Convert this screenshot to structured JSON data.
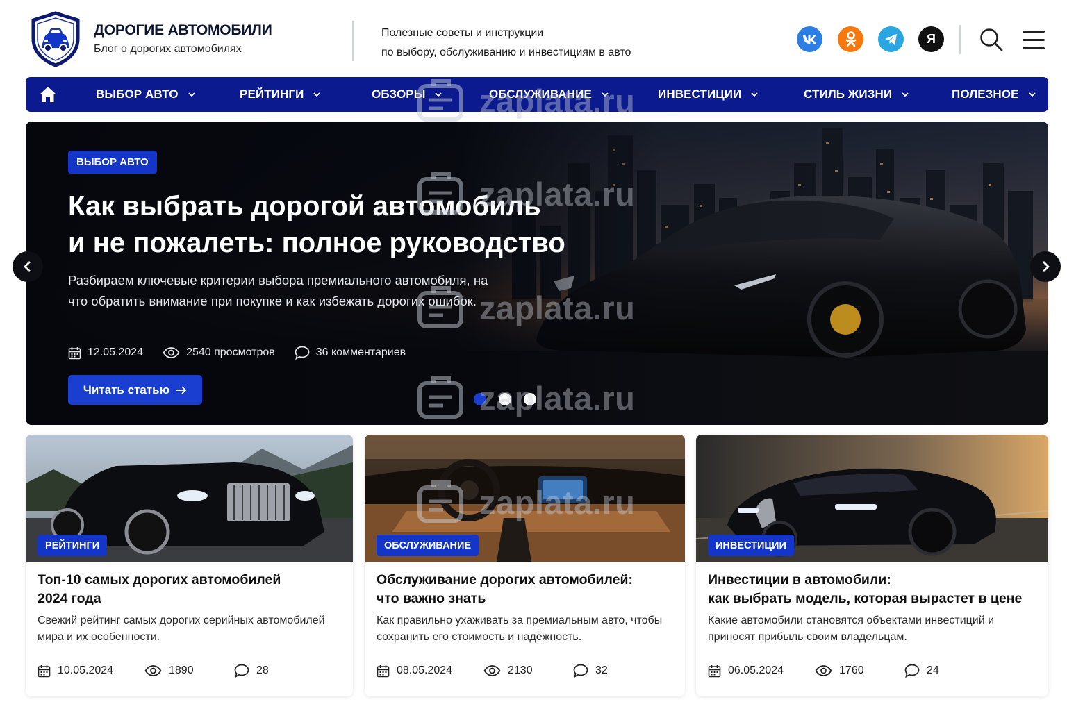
{
  "brand": {
    "title": "ДОРОГИЕ АВТОМОБИЛИ",
    "subtitle": "Блог о дорогих автомобилях",
    "tagline_1": "Полезные советы и инструкции",
    "tagline_2": "по выбору, обслуживанию и инвестициям в авто"
  },
  "social": [
    {
      "name": "vk",
      "label": "vk"
    },
    {
      "name": "ok",
      "label": "ok"
    },
    {
      "name": "telegram",
      "label": ""
    },
    {
      "name": "yandex",
      "label": "Я"
    }
  ],
  "nav": {
    "items": [
      {
        "label": "ВЫБОР АВТО"
      },
      {
        "label": "РЕЙТИНГИ"
      },
      {
        "label": "ОБЗОРЫ"
      },
      {
        "label": "ОБСЛУЖИВАНИЕ"
      },
      {
        "label": "ИНВЕСТИЦИИ"
      },
      {
        "label": "СТИЛЬ ЖИЗНИ"
      },
      {
        "label": "ПОЛЕЗНОЕ"
      }
    ]
  },
  "hero": {
    "tag": "ВЫБОР АВТО",
    "title_1": "Как выбрать дорогой автомобиль",
    "title_2": "и не пожалеть: полное руководство",
    "desc": "Разбираем ключевые критерии выбора премиального автомобиля, на что обратить внимание при покупке и как избежать дорогих ошибок.",
    "date": "12.05.2024",
    "views": "2540 просмотров",
    "comments": "36 комментариев",
    "button": "Читать статью",
    "active_slide": 1,
    "slide_count": 3
  },
  "cards": [
    {
      "tag": "РЕЙТИНГИ",
      "title_1": "Топ-10 самых дорогих автомобилей",
      "title_2": "2024 года",
      "desc": "Свежий рейтинг самых дорогих серийных автомобилей мира и их особенности.",
      "date": "10.05.2024",
      "views": "1890",
      "comments": "28"
    },
    {
      "tag": "ОБСЛУЖИВАНИЕ",
      "title_1": "Обслуживание дорогих автомобилей:",
      "title_2": "что важно знать",
      "desc": "Как правильно ухаживать за премиальным авто, чтобы сохранить его стоимость и надёжность.",
      "date": "08.05.2024",
      "views": "2130",
      "comments": "32"
    },
    {
      "tag": "ИНВЕСТИЦИИ",
      "title_1": "Инвестиции в автомобили:",
      "title_2": "как выбрать модель, которая вырастет в цене",
      "desc": "Какие автомобили становятся объектами инвестиций и приносят прибыль своим владельцам.",
      "date": "06.05.2024",
      "views": "1760",
      "comments": "24"
    }
  ],
  "watermark": "zaplata.ru",
  "colors": {
    "nav_bg": "#0b1b8f",
    "accent": "#1436c8",
    "button": "#1a3fd0"
  }
}
